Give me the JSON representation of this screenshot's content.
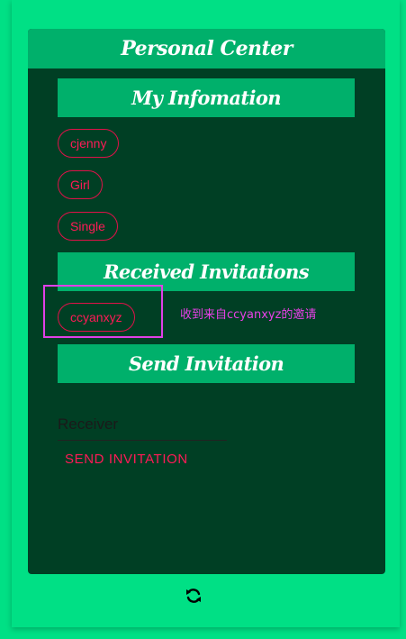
{
  "header": {
    "title": "Personal Center"
  },
  "info": {
    "title": "My Infomation",
    "username": "cjenny",
    "gender": "Girl",
    "status": "Single"
  },
  "received": {
    "title": "Received Invitations",
    "invitations": [
      {
        "from": "ccyanxyz",
        "message": "收到来自ccyanxyz的邀请"
      }
    ]
  },
  "send": {
    "title": "Send Invitation",
    "receiver_placeholder": "Receiver",
    "button_label": "SEND INVITATION"
  },
  "footer": {
    "refresh_icon": "refresh-icon"
  },
  "colors": {
    "background": "#00e085",
    "panel": "#003f24",
    "bar": "#00b06b",
    "accent": "#ff1a57",
    "highlight": "#e040e8"
  }
}
